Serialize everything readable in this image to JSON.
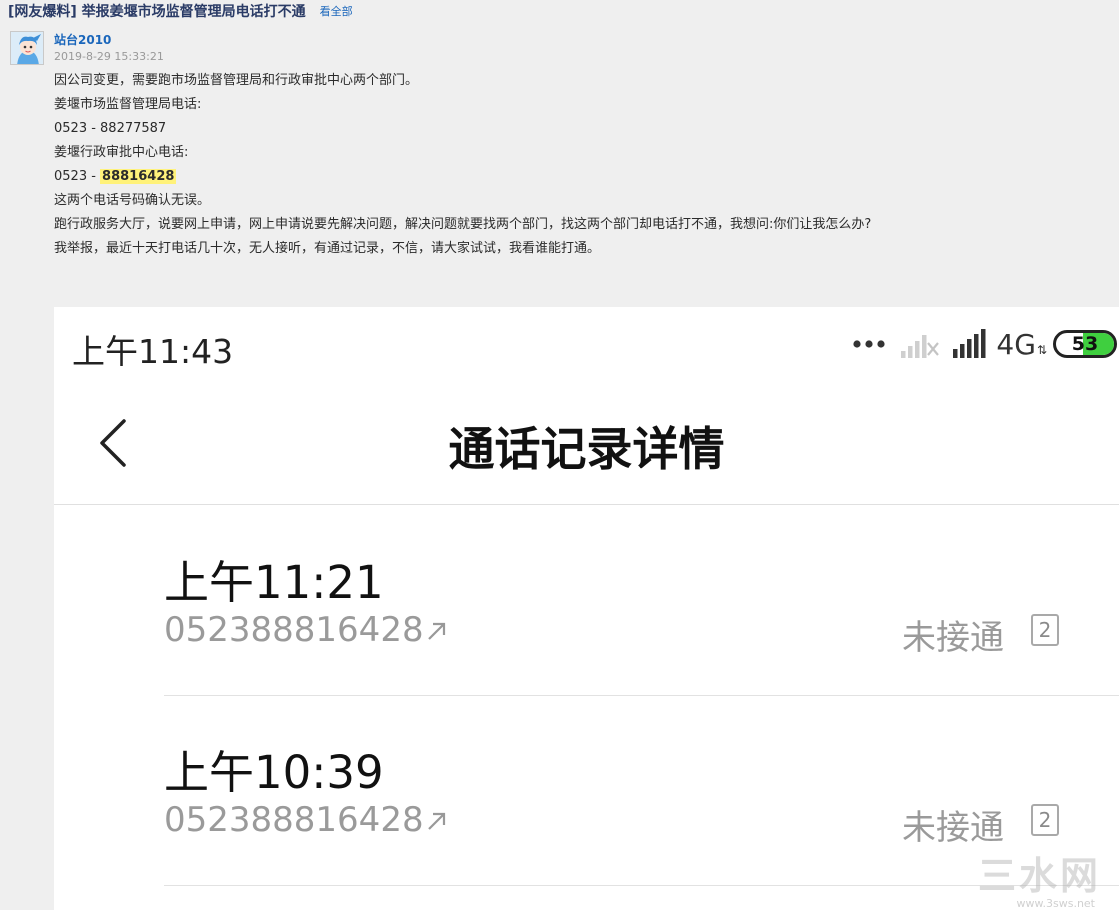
{
  "post": {
    "title": "[网友爆料] 举报姜堰市场监督管理局电话打不通",
    "see_all_label": "看全部",
    "author": "站台2010",
    "datetime": "2019-8-29 15:33:21",
    "lines": [
      "因公司变更，需要跑市场监督管理局和行政审批中心两个部门。",
      "姜堰市场监督管理局电话:",
      "0523 - 88277587",
      "姜堰行政审批中心电话:",
      "这两个电话号码确认无误。",
      "跑行政服务大厅，说要网上申请，网上申请说要先解决问题，解决问题就要找两个部门，找这两个部门却电话打不通，我想问:你们让我怎么办?",
      "我举报，最近十天打电话几十次，无人接听，有通过记录，不信，请大家试试，我看谁能打通。"
    ],
    "approval_phone_prefix": "0523 - ",
    "approval_phone_number": "88816428"
  },
  "phone": {
    "status_bar": {
      "time": "上午11:43",
      "network": "4G",
      "battery": "53",
      "battery_level": 0.53,
      "battery_color": "#3fcf3f"
    },
    "title": "通话记录详情",
    "records": [
      {
        "time": "上午11:21",
        "number": "052388816428",
        "status": "未接通",
        "sim": "2"
      },
      {
        "time": "上午10:39",
        "number": "052388816428",
        "status": "未接通",
        "sim": "2"
      }
    ]
  },
  "watermark": {
    "text": "三水网",
    "url": "www.3sws.net"
  }
}
